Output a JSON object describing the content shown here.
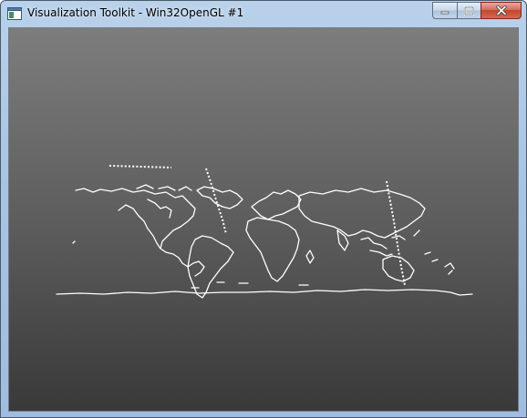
{
  "window": {
    "title": "Visualization Toolkit - Win32OpenGL #1",
    "app_icon": "window-app-icon",
    "buttons": {
      "minimize_icon": "minimize-icon",
      "maximize_icon": "maximize-icon",
      "close_icon": "close-icon"
    }
  },
  "render_view": {
    "content": "world-coastline-map",
    "background_top": "#7d7d7d",
    "background_bottom": "#393939",
    "line_color": "#ffffff"
  }
}
